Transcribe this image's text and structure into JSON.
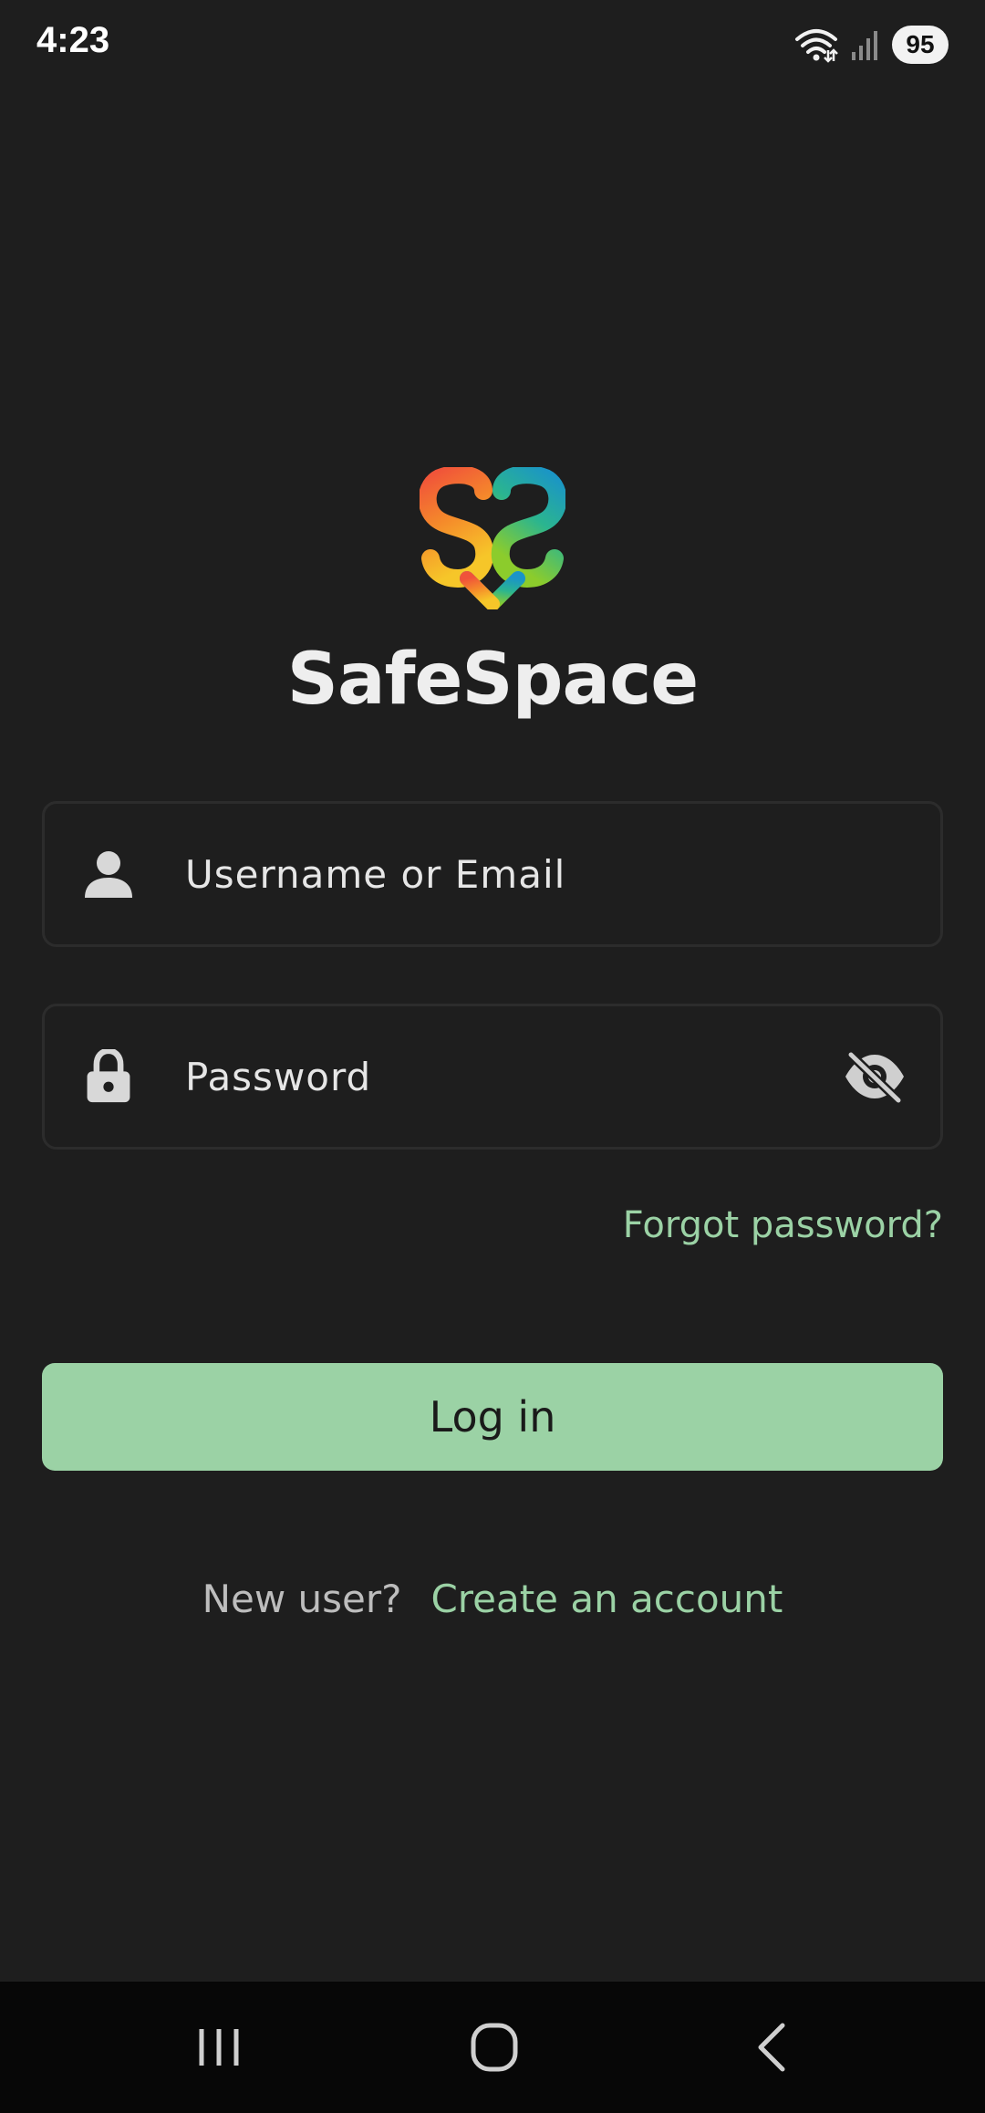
{
  "status_bar": {
    "time": "4:23",
    "battery": "95",
    "icons": [
      "wifi-icon",
      "signal-icon",
      "battery-icon"
    ]
  },
  "app": {
    "name": "SafeSpace",
    "logo_icon": "safespace-heart-logo"
  },
  "login_form": {
    "username_placeholder": "Username or Email",
    "password_placeholder": "Password",
    "forgot_password": "Forgot password?",
    "login_label": "Log in",
    "new_user_prompt": "New user?",
    "create_account": "Create an account"
  },
  "colors": {
    "background": "#1e1e1e",
    "accent": "#9bd2a5",
    "field_border": "#2c2c2c",
    "nav_bar": "#070707"
  },
  "nav_bar": {
    "buttons": [
      "recents-icon",
      "home-icon",
      "back-icon"
    ]
  }
}
